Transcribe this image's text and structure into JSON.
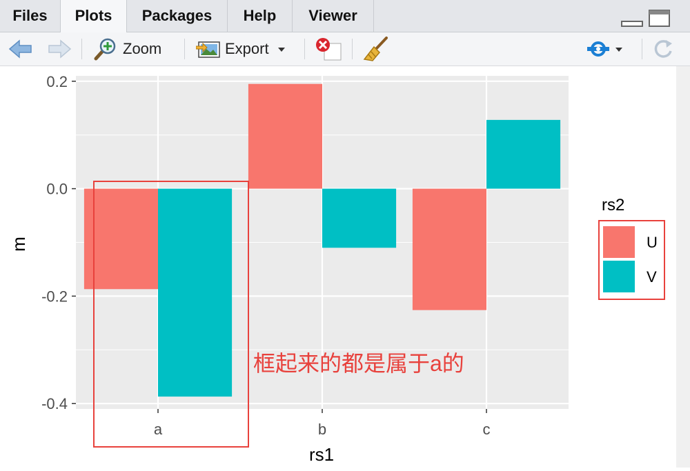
{
  "tabs": [
    {
      "label": "Files",
      "active": false
    },
    {
      "label": "Plots",
      "active": true
    },
    {
      "label": "Packages",
      "active": false
    },
    {
      "label": "Help",
      "active": false
    },
    {
      "label": "Viewer",
      "active": false
    }
  ],
  "toolbar": {
    "back_icon": "arrow-left-icon",
    "forward_icon": "arrow-right-icon",
    "zoom_label": "Zoom",
    "export_label": "Export",
    "remove_icon": "remove-plot-icon",
    "clear_icon": "broom-icon",
    "publish_icon": "publish-icon",
    "refresh_icon": "refresh-icon"
  },
  "colors": {
    "U": "#F8766D",
    "V": "#00BFC4",
    "panel": "#EBEBEB",
    "annotation": "#E8413C"
  },
  "chart_data": {
    "type": "bar",
    "categories": [
      "a",
      "b",
      "c"
    ],
    "series": [
      {
        "name": "U",
        "values": [
          -0.187,
          0.195,
          -0.226
        ]
      },
      {
        "name": "V",
        "values": [
          -0.387,
          -0.11,
          0.128
        ]
      }
    ],
    "xlabel": "rs1",
    "ylabel": "m",
    "ylim": [
      -0.41,
      0.21
    ],
    "yticks": [
      0.2,
      0.0,
      -0.2,
      -0.4
    ],
    "ytick_labels": [
      "0.2",
      "0.0",
      "-0.2",
      "-0.4"
    ],
    "legend_title": "rs2",
    "legend_position": "right",
    "grid": true
  },
  "annotation": {
    "text": "框起来的都是属于a的"
  }
}
